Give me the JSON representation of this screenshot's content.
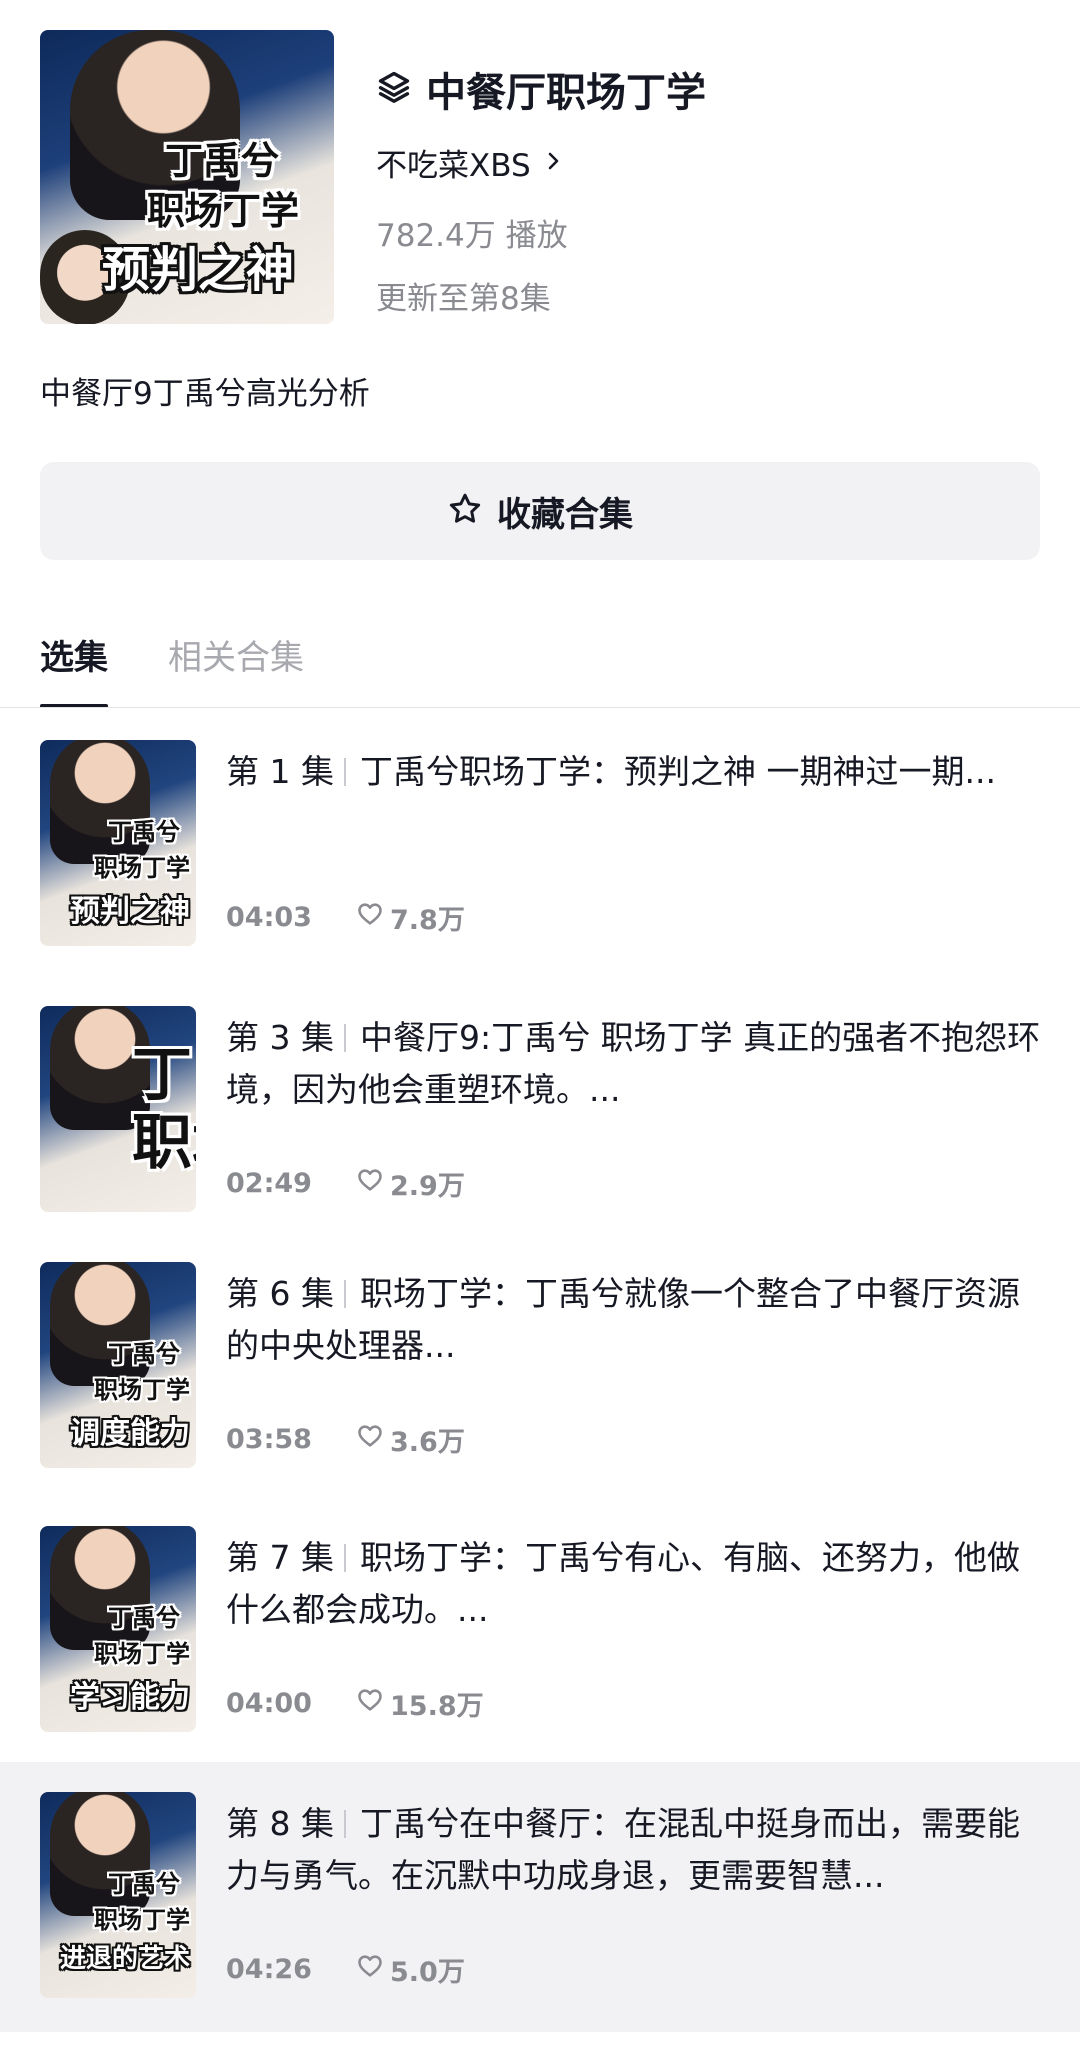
{
  "collection": {
    "title": "中餐厅职场丁学",
    "author": "不吃菜XBS",
    "plays": "782.4万 播放",
    "updated": "更新至第8集",
    "description": "中餐厅9丁禹兮高光分析",
    "cover_captions": [
      "丁禹兮",
      "职场丁学",
      "预判之神"
    ],
    "favorite_label": "收藏合集"
  },
  "tabs": [
    {
      "label": "选集",
      "active": true
    },
    {
      "label": "相关合集",
      "active": false
    }
  ],
  "episodes": [
    {
      "no": "第 1 集",
      "title": "丁禹兮职场丁学：预判之神 一期神过一期...",
      "duration": "04:03",
      "likes": "7.8万",
      "thumb": [
        "丁禹兮",
        "职场丁学",
        "预判之神"
      ]
    },
    {
      "no": "第 3 集",
      "title": "中餐厅9:丁禹兮 职场丁学 真正的强者不抱怨环境，因为他会重塑环境。...",
      "duration": "02:49",
      "likes": "2.9万",
      "thumb": [
        "丁",
        "职场"
      ]
    },
    {
      "no": "第 6 集",
      "title": "职场丁学：丁禹兮就像一个整合了中餐厅资源的中央处理器...",
      "duration": "03:58",
      "likes": "3.6万",
      "thumb": [
        "丁禹兮",
        "职场丁学",
        "调度能力"
      ]
    },
    {
      "no": "第 7 集",
      "title": "职场丁学：丁禹兮有心、有脑、还努力，他做什么都会成功。...",
      "duration": "04:00",
      "likes": "15.8万",
      "thumb": [
        "丁禹兮",
        "职场丁学",
        "学习能力"
      ]
    },
    {
      "no": "第 8 集",
      "title": "丁禹兮在中餐厅：在混乱中挺身而出，需要能力与勇气。在沉默中功成身退，更需要智慧...",
      "duration": "04:26",
      "likes": "5.0万",
      "thumb": [
        "丁禹兮",
        "职场丁学",
        "进退的艺术"
      ],
      "current": true
    }
  ]
}
